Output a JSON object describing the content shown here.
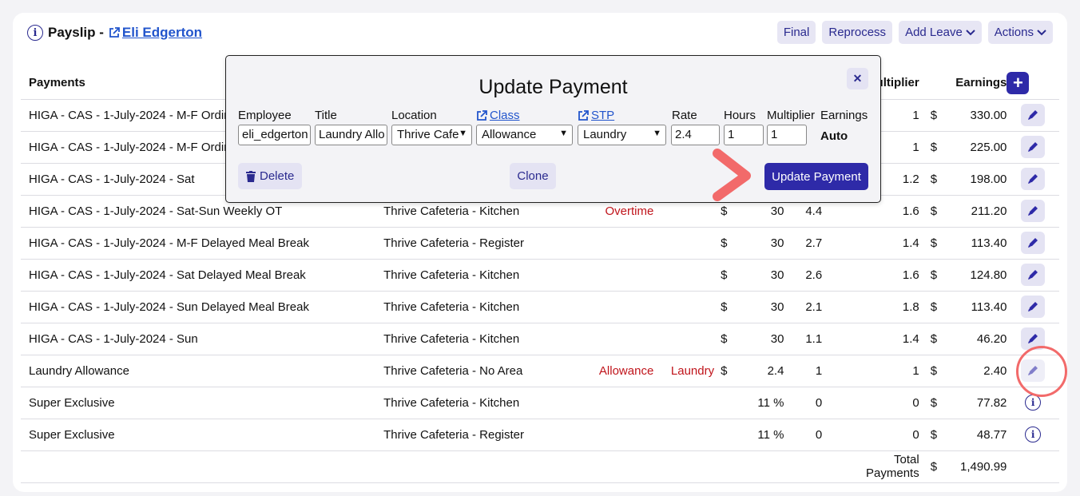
{
  "header": {
    "title": "Payslip -",
    "employee_link": "Eli Edgerton"
  },
  "toolbar": {
    "final": "Final",
    "reprocess": "Reprocess",
    "add_leave": "Add Leave",
    "actions": "Actions"
  },
  "table": {
    "headers": {
      "payments": "Payments",
      "multiplier": "Multiplier",
      "earnings": "Earnings"
    },
    "rows": [
      {
        "name": "HIGA - CAS - 1-July-2024 - M-F Ordinary",
        "location": "",
        "class": "",
        "stp": "",
        "dollar1": "",
        "rate": "",
        "hours": "",
        "multiplier": "1",
        "dollar2": "$",
        "earnings": "330.00",
        "action": "edit"
      },
      {
        "name": "HIGA - CAS - 1-July-2024 - M-F Ordinary",
        "location": "",
        "class": "",
        "stp": "",
        "dollar1": "",
        "rate": "",
        "hours": "",
        "multiplier": "1",
        "dollar2": "$",
        "earnings": "225.00",
        "action": "edit"
      },
      {
        "name": "HIGA - CAS - 1-July-2024 - Sat",
        "location": "",
        "class": "",
        "stp": "",
        "dollar1": "",
        "rate": "",
        "hours": "",
        "multiplier": "1.2",
        "dollar2": "$",
        "earnings": "198.00",
        "action": "edit"
      },
      {
        "name": "HIGA - CAS - 1-July-2024 - Sat-Sun Weekly OT",
        "location": "Thrive Cafeteria - Kitchen",
        "class": "Overtime",
        "stp": "",
        "dollar1": "$",
        "rate": "30",
        "hours": "4.4",
        "multiplier": "1.6",
        "dollar2": "$",
        "earnings": "211.20",
        "action": "edit"
      },
      {
        "name": "HIGA - CAS - 1-July-2024 - M-F Delayed Meal Break",
        "location": "Thrive Cafeteria - Register",
        "class": "",
        "stp": "",
        "dollar1": "$",
        "rate": "30",
        "hours": "2.7",
        "multiplier": "1.4",
        "dollar2": "$",
        "earnings": "113.40",
        "action": "edit"
      },
      {
        "name": "HIGA - CAS - 1-July-2024 - Sat Delayed Meal Break",
        "location": "Thrive Cafeteria - Kitchen",
        "class": "",
        "stp": "",
        "dollar1": "$",
        "rate": "30",
        "hours": "2.6",
        "multiplier": "1.6",
        "dollar2": "$",
        "earnings": "124.80",
        "action": "edit"
      },
      {
        "name": "HIGA - CAS - 1-July-2024 - Sun Delayed Meal Break",
        "location": "Thrive Cafeteria - Kitchen",
        "class": "",
        "stp": "",
        "dollar1": "$",
        "rate": "30",
        "hours": "2.1",
        "multiplier": "1.8",
        "dollar2": "$",
        "earnings": "113.40",
        "action": "edit"
      },
      {
        "name": "HIGA - CAS - 1-July-2024 - Sun",
        "location": "Thrive Cafeteria - Kitchen",
        "class": "",
        "stp": "",
        "dollar1": "$",
        "rate": "30",
        "hours": "1.1",
        "multiplier": "1.4",
        "dollar2": "$",
        "earnings": "46.20",
        "action": "edit"
      },
      {
        "name": "Laundry Allowance",
        "location": "Thrive Cafeteria - No Area",
        "class": "Allowance",
        "stp": "Laundry",
        "dollar1": "$",
        "rate": "2.4",
        "hours": "1",
        "multiplier": "1",
        "dollar2": "$",
        "earnings": "2.40",
        "action": "edit-dim"
      },
      {
        "name": "Super Exclusive",
        "location": "Thrive Cafeteria - Kitchen",
        "class": "",
        "stp": "",
        "dollar1": "",
        "rate": "11 %",
        "hours": "0",
        "multiplier": "0",
        "dollar2": "$",
        "earnings": "77.82",
        "action": "info"
      },
      {
        "name": "Super Exclusive",
        "location": "Thrive Cafeteria - Register",
        "class": "",
        "stp": "",
        "dollar1": "",
        "rate": "11 %",
        "hours": "0",
        "multiplier": "0",
        "dollar2": "$",
        "earnings": "48.77",
        "action": "info"
      }
    ],
    "total": {
      "label": "Total Payments",
      "dollar": "$",
      "value": "1,490.99"
    }
  },
  "modal": {
    "title": "Update Payment",
    "labels": {
      "employee": "Employee",
      "title": "Title",
      "location": "Location",
      "class": "Class",
      "stp": "STP",
      "rate": "Rate",
      "hours": "Hours",
      "multiplier": "Multiplier",
      "earnings": "Earnings"
    },
    "values": {
      "employee": "eli_edgerton",
      "title": "Laundry Allo",
      "location": "Thrive Cafe",
      "class": "Allowance",
      "stp": "Laundry",
      "rate": "2.4",
      "hours": "1",
      "multiplier": "1",
      "earnings": "Auto"
    },
    "buttons": {
      "delete": "Delete",
      "clone": "Clone",
      "update": "Update Payment"
    }
  },
  "colors": {
    "primary": "#2e2aa8",
    "accent_red": "#c0141b",
    "annotation": "#f26a6a",
    "link": "#2255cc"
  },
  "icons": [
    "info-icon",
    "external-link-icon",
    "chevron-down-icon",
    "plus-icon",
    "pencil-icon",
    "close-icon",
    "trash-icon"
  ]
}
